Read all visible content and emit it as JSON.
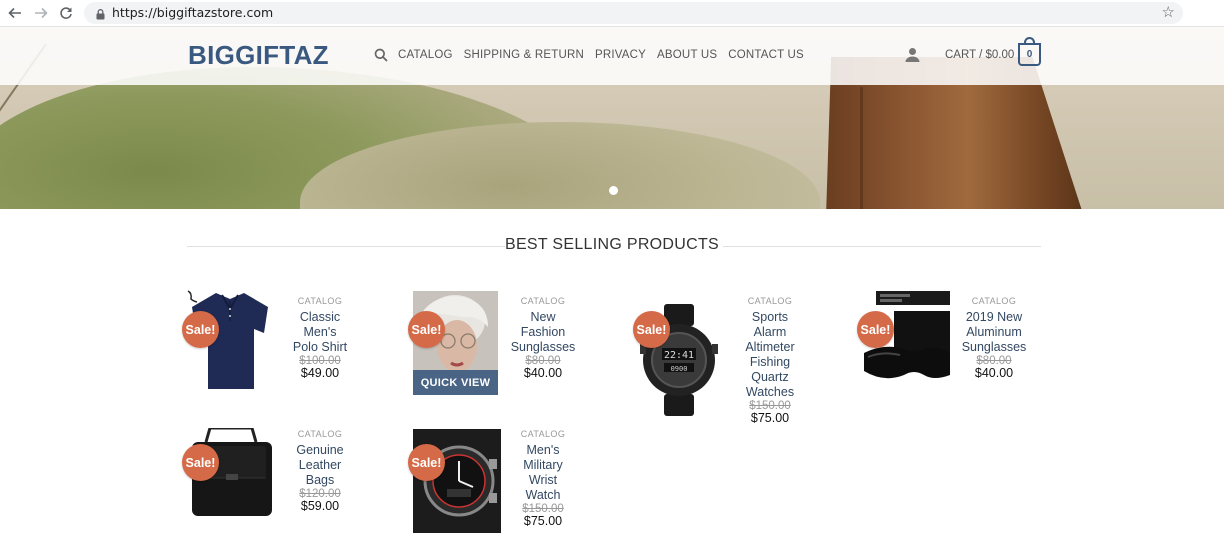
{
  "browser": {
    "url": "https://biggiftazstore.com"
  },
  "site": {
    "logo": "BIGGIFTAZ",
    "menu": [
      "CATALOG",
      "SHIPPING & RETURN",
      "PRIVACY",
      "ABOUT US",
      "CONTACT US"
    ],
    "cart_label": "CART / $0.00",
    "cart_count": "0"
  },
  "section": {
    "title": "BEST SELLING PRODUCTS"
  },
  "products": [
    {
      "category": "CATALOG",
      "name_lines": [
        "Classic",
        "Men's",
        "Polo Shirt"
      ],
      "old_price": "$100.00",
      "price": "$49.00",
      "badge": "Sale!"
    },
    {
      "category": "CATALOG",
      "name_lines": [
        "New",
        "Fashion",
        "Sunglasses"
      ],
      "old_price": "$80.00",
      "price": "$40.00",
      "badge": "Sale!",
      "overlay": "QUICK VIEW"
    },
    {
      "category": "CATALOG",
      "name_lines": [
        "Sports",
        "Alarm",
        "Altimeter",
        "Fishing",
        "Quartz",
        "Watches"
      ],
      "old_price": "$150.00",
      "price": "$75.00",
      "badge": "Sale!"
    },
    {
      "category": "CATALOG",
      "name_lines": [
        "2019 New",
        "Aluminum",
        "Sunglasses"
      ],
      "old_price": "$80.00",
      "price": "$40.00",
      "badge": "Sale!"
    },
    {
      "category": "CATALOG",
      "name_lines": [
        "Genuine",
        "Leather",
        "Bags"
      ],
      "old_price": "$120.00",
      "price": "$59.00",
      "badge": "Sale!"
    },
    {
      "category": "CATALOG",
      "name_lines": [
        "Men's",
        "Military",
        "Wrist",
        "Watch"
      ],
      "old_price": "$150.00",
      "price": "$75.00",
      "badge": "Sale!"
    }
  ],
  "colors": {
    "brand": "#3a5980",
    "sale": "#d56a48",
    "quick_view": "#4a6485"
  },
  "icons": [
    "back-arrow-icon",
    "forward-arrow-icon",
    "reload-icon",
    "lock-icon",
    "bookmark-star-icon",
    "search-icon",
    "user-icon",
    "cart-icon"
  ]
}
